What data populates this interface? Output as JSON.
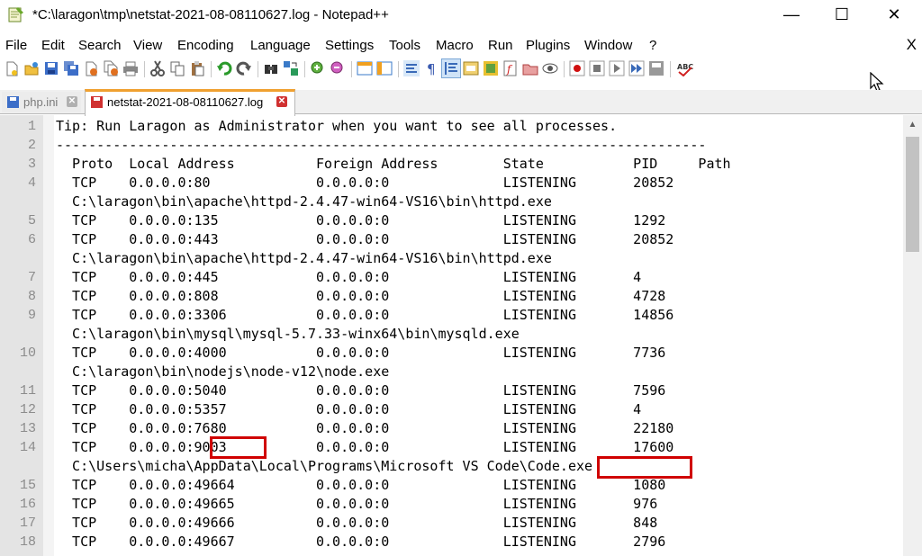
{
  "window": {
    "title": "*C:\\laragon\\tmp\\netstat-2021-08-08110627.log - Notepad++",
    "minimize": "—",
    "maximize": "☐",
    "close": "✕"
  },
  "menu": {
    "items": [
      "File",
      "Edit",
      "Search",
      "View",
      "Encoding",
      "Language",
      "Settings",
      "Tools",
      "Macro",
      "Run",
      "Plugins",
      "Window",
      "?"
    ],
    "close_label": "X"
  },
  "tabs": [
    {
      "label": "php.ini",
      "active": false
    },
    {
      "label": "netstat-2021-08-08110627.log",
      "active": true
    }
  ],
  "editor": {
    "lines": [
      {
        "n": "1",
        "text": "Tip: Run Laragon as Administrator when you want to see all processes."
      },
      {
        "n": "2",
        "text": "--------------------------------------------------------------------------------"
      },
      {
        "n": "3",
        "text": "  Proto  Local Address          Foreign Address        State           PID     Path"
      },
      {
        "n": "4",
        "text": "  TCP    0.0.0.0:80             0.0.0.0:0              LISTENING       20852"
      },
      {
        "n": "",
        "text": "  C:\\laragon\\bin\\apache\\httpd-2.4.47-win64-VS16\\bin\\httpd.exe"
      },
      {
        "n": "5",
        "text": "  TCP    0.0.0.0:135            0.0.0.0:0              LISTENING       1292"
      },
      {
        "n": "6",
        "text": "  TCP    0.0.0.0:443            0.0.0.0:0              LISTENING       20852"
      },
      {
        "n": "",
        "text": "  C:\\laragon\\bin\\apache\\httpd-2.4.47-win64-VS16\\bin\\httpd.exe"
      },
      {
        "n": "7",
        "text": "  TCP    0.0.0.0:445            0.0.0.0:0              LISTENING       4"
      },
      {
        "n": "8",
        "text": "  TCP    0.0.0.0:808            0.0.0.0:0              LISTENING       4728"
      },
      {
        "n": "9",
        "text": "  TCP    0.0.0.0:3306           0.0.0.0:0              LISTENING       14856"
      },
      {
        "n": "",
        "text": "  C:\\laragon\\bin\\mysql\\mysql-5.7.33-winx64\\bin\\mysqld.exe"
      },
      {
        "n": "10",
        "text": "  TCP    0.0.0.0:4000           0.0.0.0:0              LISTENING       7736"
      },
      {
        "n": "",
        "text": "  C:\\laragon\\bin\\nodejs\\node-v12\\node.exe"
      },
      {
        "n": "11",
        "text": "  TCP    0.0.0.0:5040           0.0.0.0:0              LISTENING       7596"
      },
      {
        "n": "12",
        "text": "  TCP    0.0.0.0:5357           0.0.0.0:0              LISTENING       4"
      },
      {
        "n": "13",
        "text": "  TCP    0.0.0.0:7680           0.0.0.0:0              LISTENING       22180"
      },
      {
        "n": "14",
        "text": "  TCP    0.0.0.0:9003           0.0.0.0:0              LISTENING       17600"
      },
      {
        "n": "",
        "text": "  C:\\Users\\micha\\AppData\\Local\\Programs\\Microsoft VS Code\\Code.exe"
      },
      {
        "n": "15",
        "text": "  TCP    0.0.0.0:49664          0.0.0.0:0              LISTENING       1080"
      },
      {
        "n": "16",
        "text": "  TCP    0.0.0.0:49665          0.0.0.0:0              LISTENING       976"
      },
      {
        "n": "17",
        "text": "  TCP    0.0.0.0:49666          0.0.0.0:0              LISTENING       848"
      },
      {
        "n": "18",
        "text": "  TCP    0.0.0.0:49667          0.0.0.0:0              LISTENING       2796"
      }
    ]
  },
  "highlight_color": "#d00000",
  "active_tab_accent": "#f0a030"
}
